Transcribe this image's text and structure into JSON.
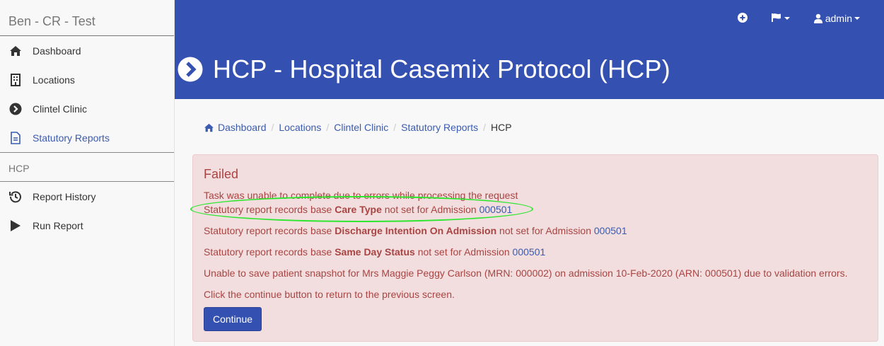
{
  "sidebar": {
    "brand": "Ben - CR - Test",
    "items": [
      {
        "label": "Dashboard",
        "icon": "home-icon"
      },
      {
        "label": "Locations",
        "icon": "building-icon"
      },
      {
        "label": "Clintel Clinic",
        "icon": "chevron-circle-right-icon"
      },
      {
        "label": "Statutory Reports",
        "icon": "document-icon"
      }
    ],
    "section_title": "HCP",
    "section_items": [
      {
        "label": "Report History",
        "icon": "history-icon"
      },
      {
        "label": "Run Report",
        "icon": "play-icon"
      }
    ]
  },
  "header": {
    "user_label": "admin",
    "title": "HCP - Hospital Casemix Protocol (HCP)"
  },
  "breadcrumb": {
    "items": [
      "Dashboard",
      "Locations",
      "Clintel Clinic",
      "Statutory Reports"
    ],
    "current": "HCP"
  },
  "alert": {
    "title": "Failed",
    "line1": "Task was unable to complete due to errors while processing the request",
    "errors": [
      {
        "prefix": "Statutory report records base ",
        "field": "Care Type",
        "suffix": " not set for Admission ",
        "admission": "000501"
      },
      {
        "prefix": "Statutory report records base ",
        "field": "Discharge Intention On Admission",
        "suffix": " not set for Admission ",
        "admission": "000501"
      },
      {
        "prefix": "Statutory report records base ",
        "field": "Same Day Status",
        "suffix": " not set for Admission ",
        "admission": "000501"
      }
    ],
    "snapshot_error": "Unable to save patient snapshot for Mrs Maggie Peggy Carlson (MRN: 000002) on admission 10-Feb-2020 (ARN: 000501) due to validation errors.",
    "instruction": "Click the continue button to return to the previous screen.",
    "continue_label": "Continue"
  },
  "colors": {
    "header_bg": "#3451b2",
    "alert_bg": "#f2dede",
    "alert_text": "#a94442",
    "link": "#3b5bb0",
    "highlight": "#2ee62e"
  }
}
